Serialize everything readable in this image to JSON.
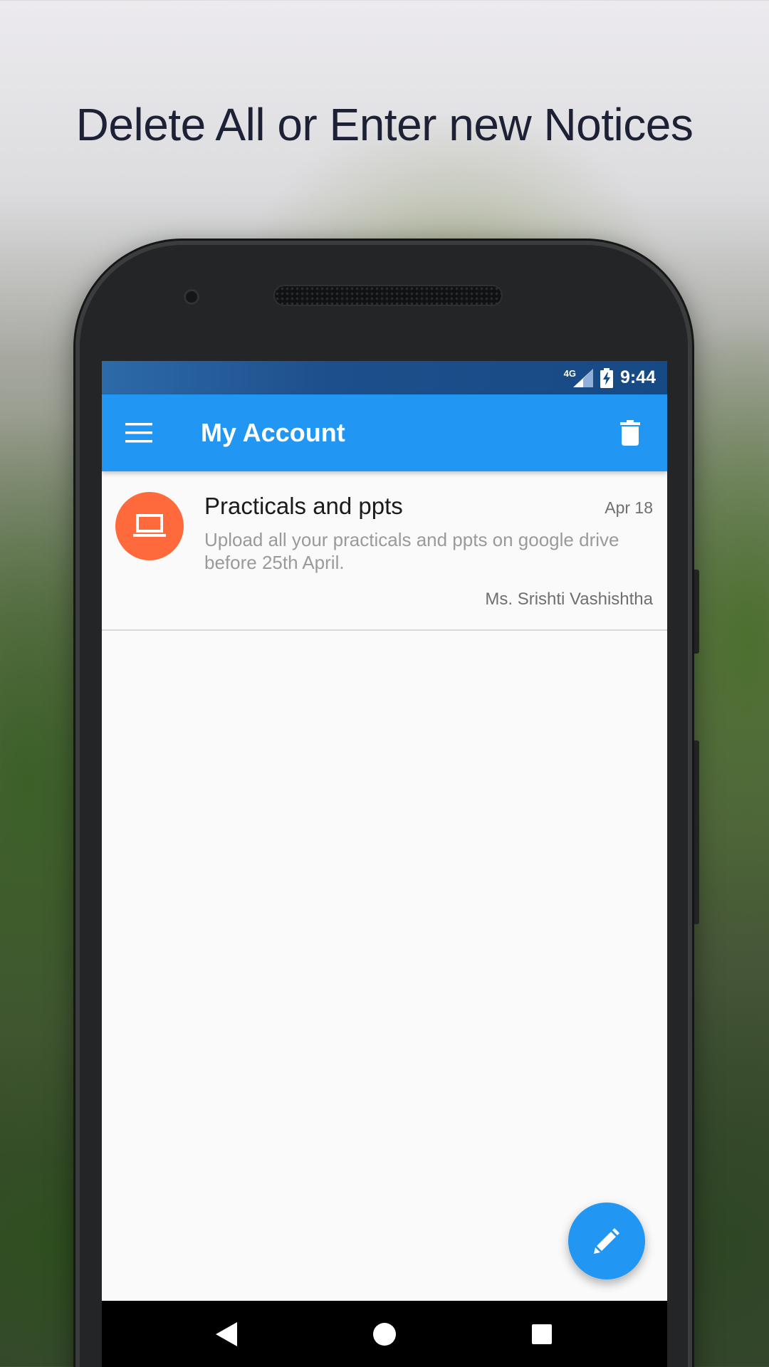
{
  "headline": "Delete All or Enter new Notices",
  "status_bar": {
    "network": "4G",
    "time": "9:44"
  },
  "app_bar": {
    "title": "My Account",
    "menu_icon": "menu-icon",
    "action_icon": "trash-icon"
  },
  "notices": [
    {
      "title": "Practicals and ppts",
      "date": "Apr 18",
      "body": "Upload all your practicals and ppts on google drive before 25th April.",
      "author": "Ms. Srishti Vashishtha",
      "avatar_icon": "laptop-icon",
      "avatar_color": "#ff6a3d"
    }
  ],
  "fab": {
    "icon": "pencil-icon"
  },
  "nav_bar": {
    "buttons": [
      "back-icon",
      "home-icon",
      "recents-icon"
    ]
  },
  "colors": {
    "primary": "#2196f3",
    "status_bar": "#174a85",
    "accent_avatar": "#ff6a3d"
  }
}
